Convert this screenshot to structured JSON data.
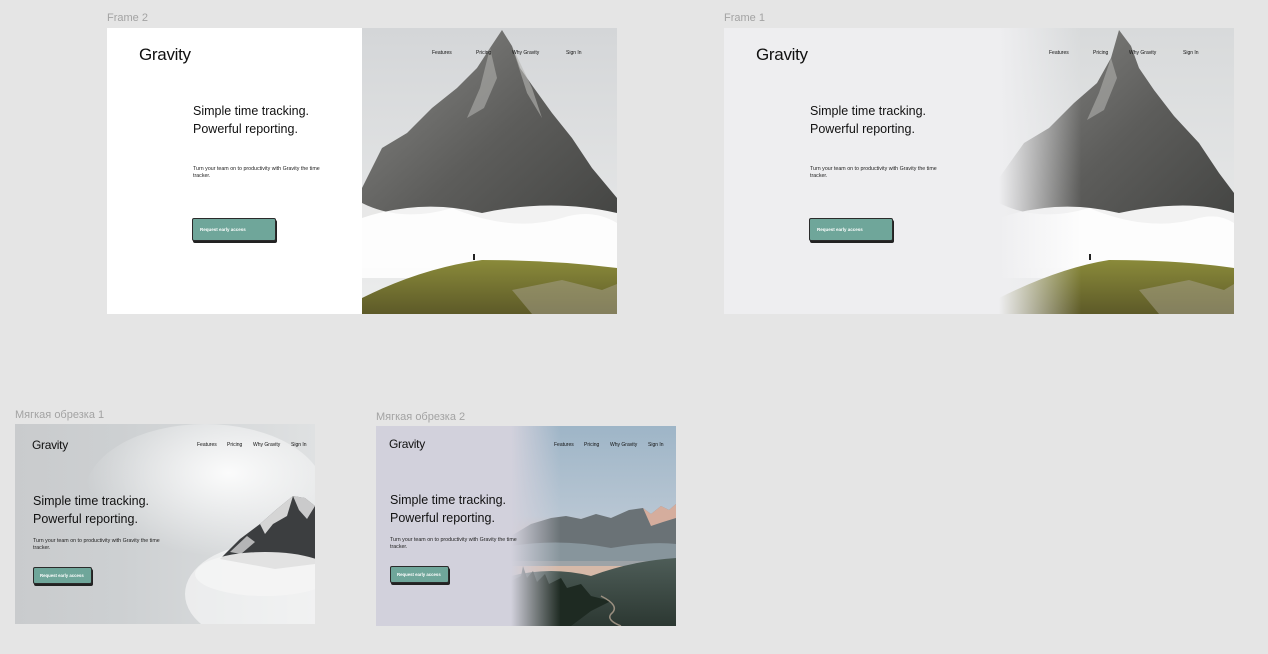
{
  "canvas": {
    "background": "#e5e5e5"
  },
  "colors": {
    "accent": "#6fa69a",
    "label": "#a3a3a3"
  },
  "frames": [
    {
      "label": "Frame 2",
      "logo": "Gravity",
      "nav": [
        "Features",
        "Pricing",
        "Why Gravity",
        "Sign In"
      ],
      "headline_line1": "Simple time tracking.",
      "headline_line2": "Powerful reporting.",
      "body": "Turn your team on to productivity with Gravity the time tracker.",
      "cta": "Request early access"
    },
    {
      "label": "Frame 1",
      "logo": "Gravity",
      "nav": [
        "Features",
        "Pricing",
        "Why Gravity",
        "Sign In"
      ],
      "headline_line1": "Simple time tracking.",
      "headline_line2": "Powerful reporting.",
      "body": "Turn your team on to productivity with Gravity the time tracker.",
      "cta": "Request early access"
    },
    {
      "label": "Мягкая обрезка 1",
      "logo": "Gravity",
      "nav": [
        "Features",
        "Pricing",
        "Why Gravity",
        "Sign In"
      ],
      "headline_line1": "Simple time tracking.",
      "headline_line2": "Powerful reporting.",
      "body": "Turn your team on to productivity with Gravity the time tracker.",
      "cta": "Request early access"
    },
    {
      "label": "Мягкая обрезка 2",
      "logo": "Gravity",
      "nav": [
        "Features",
        "Pricing",
        "Why Gravity",
        "Sign In"
      ],
      "headline_line1": "Simple time tracking.",
      "headline_line2": "Powerful reporting.",
      "body": "Turn your team on to productivity with Gravity the time tracker.",
      "cta": "Request early access"
    }
  ]
}
